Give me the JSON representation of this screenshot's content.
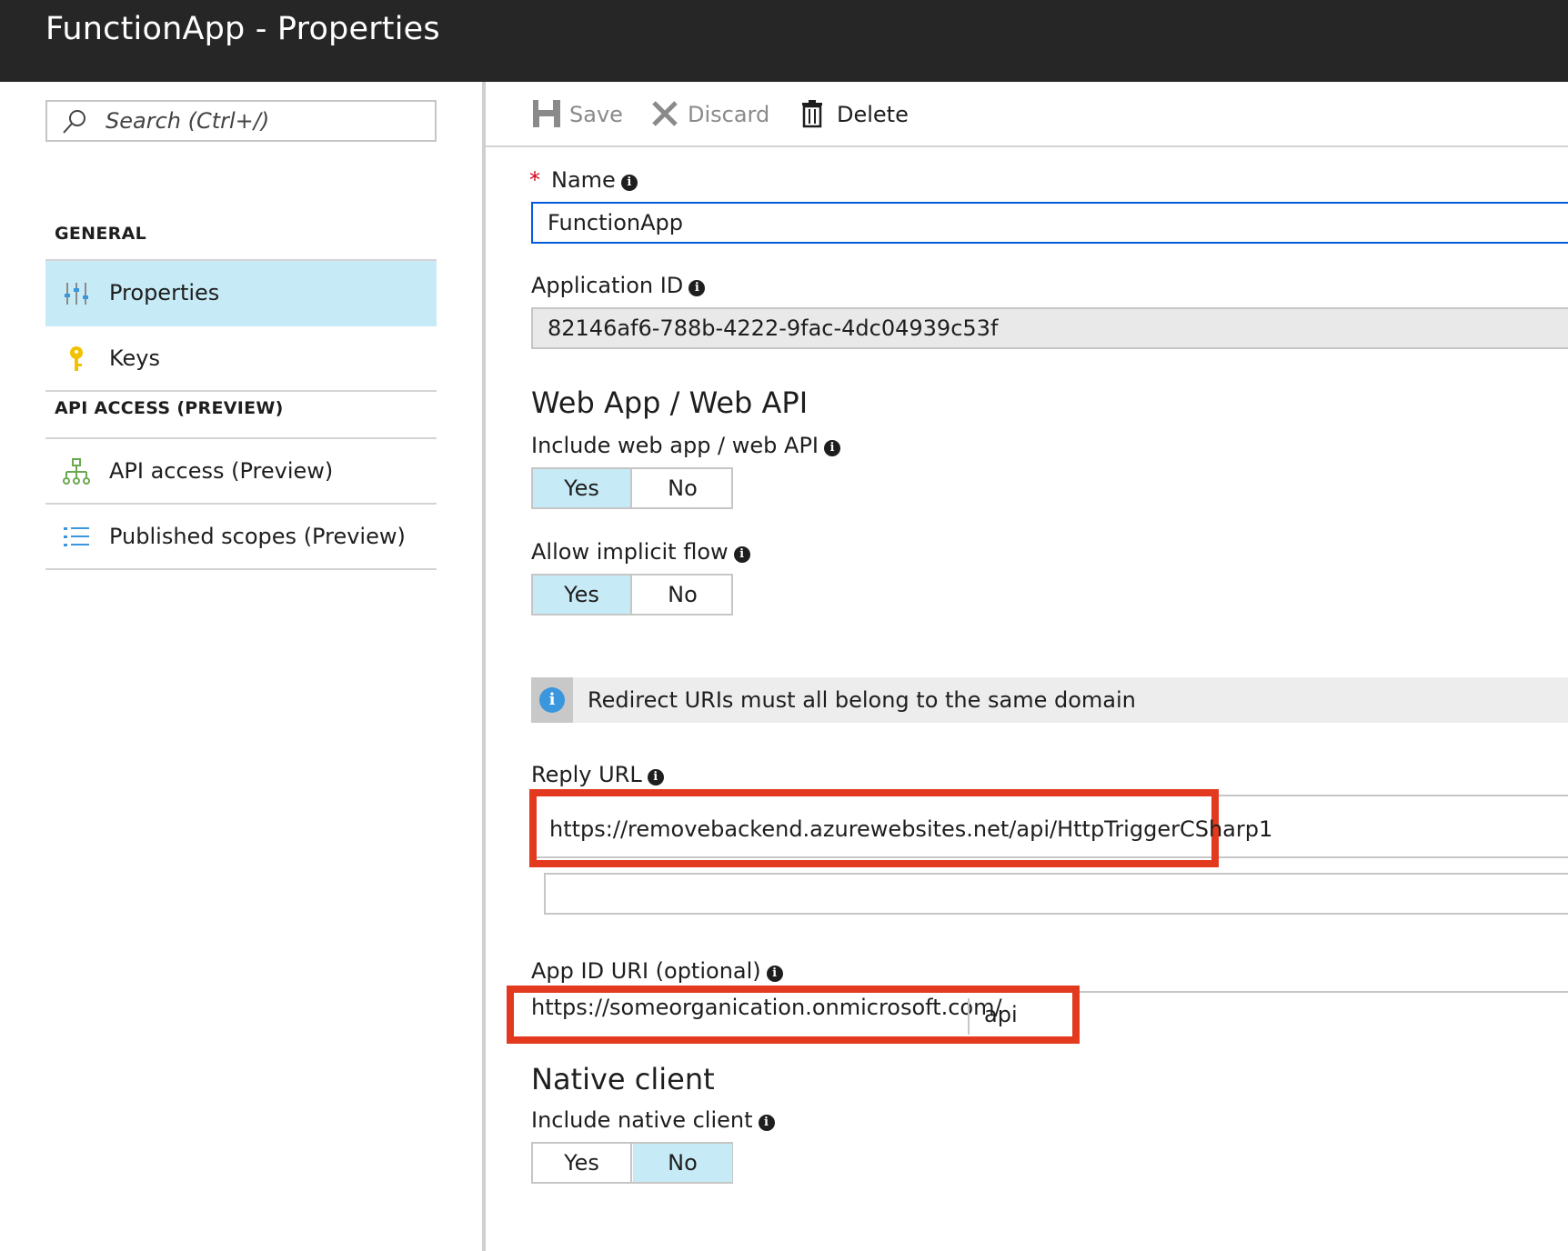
{
  "window": {
    "title": "FunctionApp - Properties"
  },
  "search": {
    "placeholder": "Search (Ctrl+/)"
  },
  "nav": {
    "sections": [
      {
        "header": "GENERAL",
        "items": [
          {
            "label": "Properties",
            "icon": "sliders-icon",
            "selected": true
          },
          {
            "label": "Keys",
            "icon": "key-icon",
            "selected": false
          }
        ]
      },
      {
        "header": "API ACCESS (PREVIEW)",
        "items": [
          {
            "label": "API access (Preview)",
            "icon": "hierarchy-icon",
            "selected": false
          },
          {
            "label": "Published scopes (Preview)",
            "icon": "list-icon",
            "selected": false
          }
        ]
      }
    ]
  },
  "toolbar": {
    "save_label": "Save",
    "discard_label": "Discard",
    "delete_label": "Delete"
  },
  "form": {
    "required_mark": "*",
    "name_label": "Name",
    "name_value": "FunctionApp",
    "app_id_label": "Application ID",
    "app_id_value": "82146af6-788b-4222-9fac-4dc04939c53f",
    "webapp_heading": "Web App / Web API",
    "include_webapp_label": "Include web app / web API",
    "include_webapp": {
      "yes": "Yes",
      "no": "No",
      "selected": "Yes"
    },
    "implicit_flow_label": "Allow implicit flow",
    "implicit_flow": {
      "yes": "Yes",
      "no": "No",
      "selected": "Yes"
    },
    "info_message": "Redirect URIs must all belong to the same domain",
    "reply_url_label": "Reply URL",
    "reply_url_value": "https://removebackend.azurewebsites.net/api/HttpTriggerCSharp1",
    "reply_url_new_value": "",
    "app_id_uri_label": "App ID URI (optional)",
    "app_id_uri_prefix": "https://someorganication.onmicrosoft.com/",
    "app_id_uri_value": "api",
    "native_heading": "Native client",
    "include_native_label": "Include native client",
    "include_native": {
      "yes": "Yes",
      "no": "No",
      "selected": "No"
    }
  },
  "colors": {
    "titlebar": "#262626",
    "selected_bg": "#c7ebf6",
    "highlight": "#e3391f",
    "focus_border": "#015cda",
    "required": "#d0021b"
  }
}
